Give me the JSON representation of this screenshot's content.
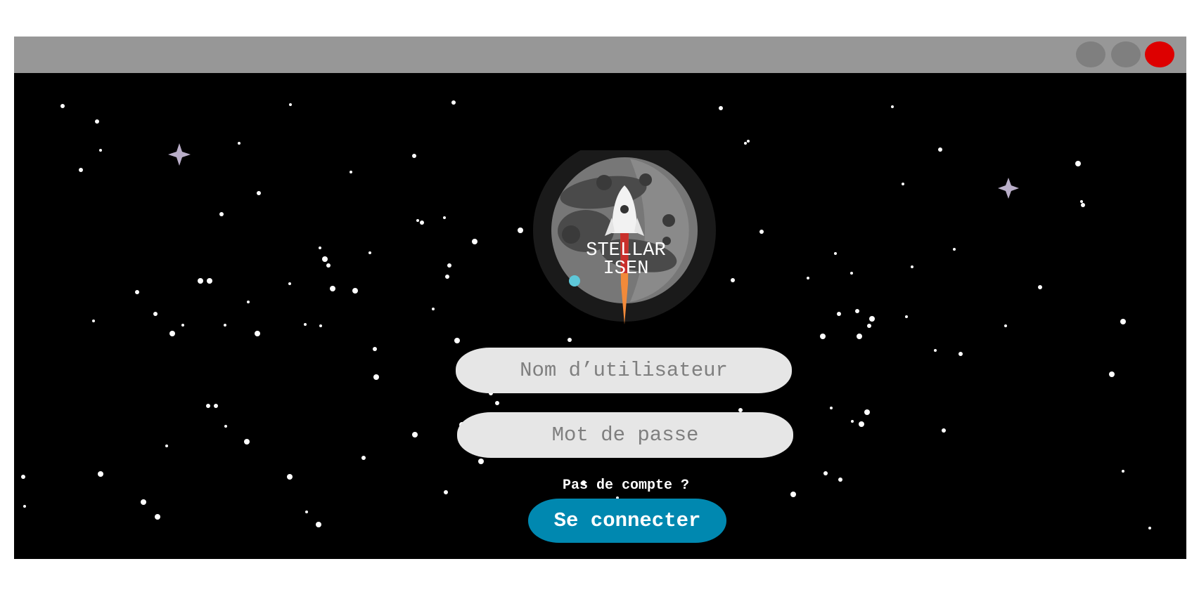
{
  "window": {
    "title_bar_color": "#979797",
    "background_color": "#000000",
    "controls": [
      {
        "icon": "minimize-icon",
        "color": "#7f7f7f"
      },
      {
        "icon": "maximize-icon",
        "color": "#7f7f7f"
      },
      {
        "icon": "close-icon",
        "color": "#dd0000"
      }
    ]
  },
  "logo": {
    "line1": "STELLAR",
    "line2": "ISEN",
    "icon": "rocket-moon-icon"
  },
  "form": {
    "username_placeholder": "Nom d’utilisateur",
    "username_value": "",
    "password_placeholder": "Mot de passe",
    "password_value": "",
    "no_account_text": "Pas de compte ?",
    "submit_label": "Se connecter",
    "accent_color": "#0088b0",
    "field_color": "#e6e6e6"
  }
}
